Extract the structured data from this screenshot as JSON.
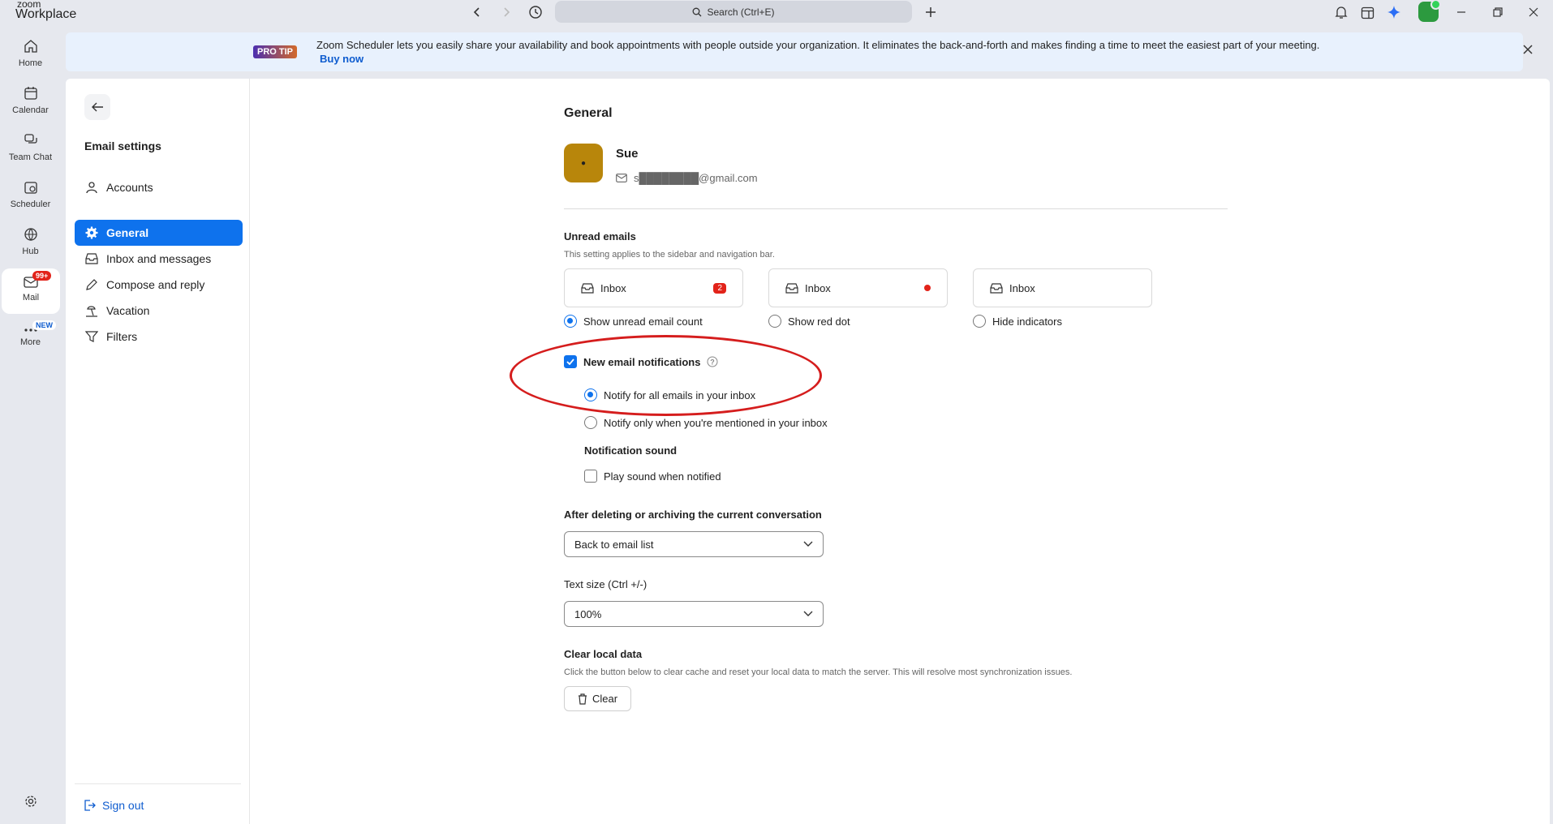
{
  "titlebar": {
    "brand_small": "zoom",
    "brand_big": "Workplace",
    "search_label": "Search (Ctrl+E)"
  },
  "rail": {
    "items": [
      {
        "label": "Home",
        "icon": "home-icon"
      },
      {
        "label": "Calendar",
        "icon": "calendar-icon"
      },
      {
        "label": "Team Chat",
        "icon": "chat-icon"
      },
      {
        "label": "Scheduler",
        "icon": "scheduler-icon"
      },
      {
        "label": "Hub",
        "icon": "hub-icon"
      },
      {
        "label": "Mail",
        "icon": "mail-icon",
        "badge": "99+"
      },
      {
        "label": "More",
        "icon": "more-icon",
        "badge": "NEW"
      }
    ]
  },
  "banner": {
    "tag": "PRO TIP",
    "text": "Zoom Scheduler lets you easily share your availability and book appointments with people outside your organization. It eliminates the back-and-forth and makes finding a time to meet the easiest part of your meeting.",
    "link": "Buy now"
  },
  "sidebar": {
    "title": "Email settings",
    "items": [
      {
        "label": "Accounts",
        "icon": "person-icon"
      },
      {
        "label": "General",
        "icon": "gear-icon",
        "active": true
      },
      {
        "label": "Inbox and messages",
        "icon": "inbox-icon"
      },
      {
        "label": "Compose and reply",
        "icon": "pencil-icon"
      },
      {
        "label": "Vacation",
        "icon": "beach-icon"
      },
      {
        "label": "Filters",
        "icon": "filter-icon"
      }
    ],
    "signout": "Sign out"
  },
  "main": {
    "heading": "General",
    "user": {
      "name": "Sue",
      "email": "s████████@gmail.com"
    },
    "unread": {
      "title": "Unread emails",
      "subtitle": "This setting applies to the sidebar and navigation bar.",
      "cards": [
        {
          "label": "Inbox",
          "count": "2"
        },
        {
          "label": "Inbox"
        },
        {
          "label": "Inbox"
        }
      ],
      "options": [
        "Show unread email count",
        "Show red dot",
        "Hide indicators"
      ],
      "selected": "Show unread email count"
    },
    "notifications": {
      "label": "New email notifications",
      "checked": true,
      "options": [
        "Notify for all emails in your inbox",
        "Notify only when you're mentioned in your inbox"
      ],
      "selected": "Notify for all emails in your inbox",
      "sound_title": "Notification sound",
      "sound_label": "Play sound when notified",
      "sound_checked": false
    },
    "after_delete": {
      "title": "After deleting or archiving the current conversation",
      "value": "Back to email list"
    },
    "text_size": {
      "title": "Text size (Ctrl +/-)",
      "value": "100%"
    },
    "clear_data": {
      "title": "Clear local data",
      "subtitle": "Click the button below to clear cache and reset your local data to match the server. This will resolve most synchronization issues.",
      "button": "Clear"
    }
  },
  "colors": {
    "accent": "#0e72ed",
    "badge": "#e2231a",
    "annotation": "#d51d1d"
  }
}
